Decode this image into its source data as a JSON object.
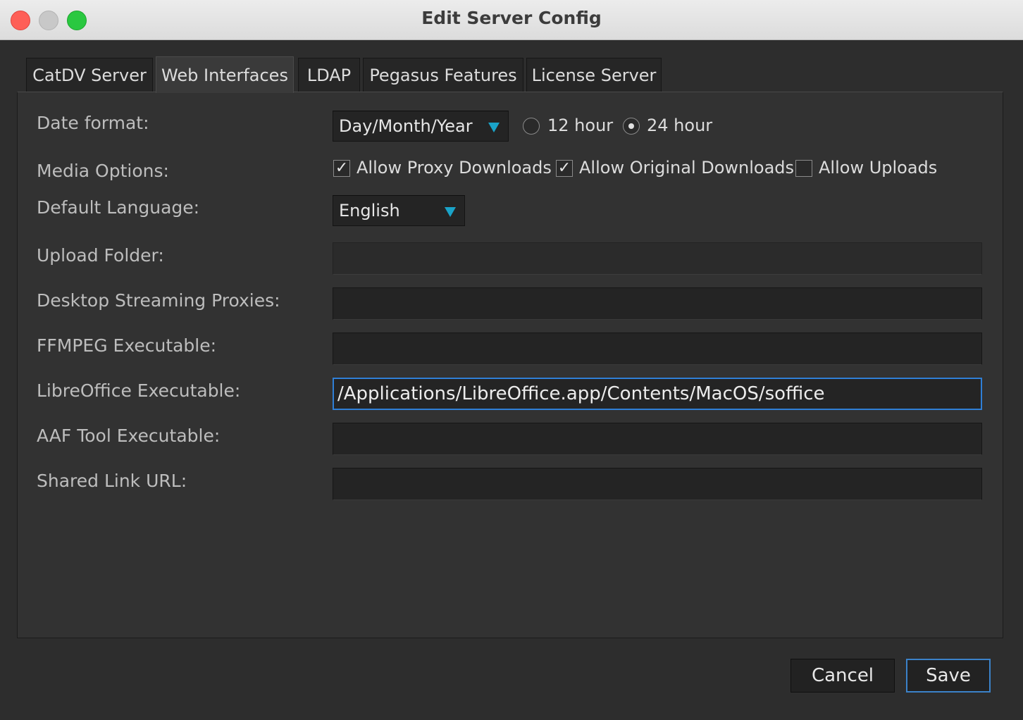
{
  "window": {
    "title": "Edit Server Config"
  },
  "tabs": [
    {
      "label": "CatDV Server"
    },
    {
      "label": "Web Interfaces"
    },
    {
      "label": "LDAP"
    },
    {
      "label": "Pegasus Features"
    },
    {
      "label": "License Server"
    }
  ],
  "form": {
    "date_format": {
      "label": "Date format:",
      "selected": "Day/Month/Year",
      "hour12_label": "12 hour",
      "hour24_label": "24 hour",
      "hour_mode": "24 hour"
    },
    "media_options": {
      "label": "Media Options:",
      "proxy_label": "Allow Proxy Downloads",
      "proxy_checked": true,
      "original_label": "Allow Original Downloads",
      "original_checked": true,
      "uploads_label": "Allow Uploads",
      "uploads_checked": false
    },
    "default_language": {
      "label": "Default Language:",
      "selected": "English"
    },
    "upload_folder": {
      "label": "Upload Folder:",
      "value": ""
    },
    "desktop_streaming": {
      "label": "Desktop Streaming Proxies:",
      "value": ""
    },
    "ffmpeg": {
      "label": "FFMPEG Executable:",
      "value": ""
    },
    "libreoffice": {
      "label": "LibreOffice Executable:",
      "value": "/Applications/LibreOffice.app/Contents/MacOS/soffice"
    },
    "aaf_tool": {
      "label": "AAF Tool Executable:",
      "value": ""
    },
    "shared_link": {
      "label": "Shared Link URL:",
      "value": ""
    }
  },
  "buttons": {
    "cancel": "Cancel",
    "save": "Save"
  },
  "colors": {
    "accent": "#2f7fd6",
    "combo_arrow": "#1aa3c8"
  }
}
